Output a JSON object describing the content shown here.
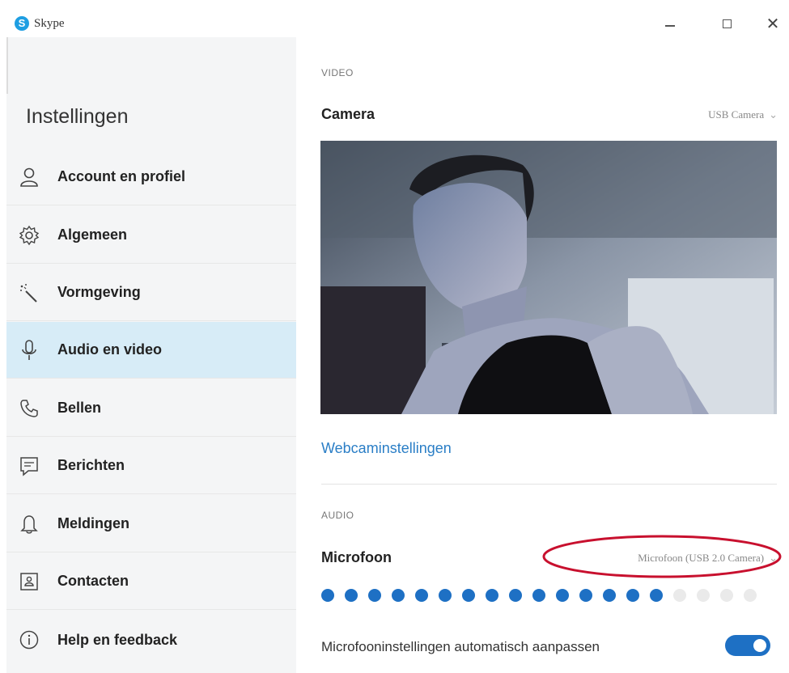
{
  "window": {
    "title": "Skype",
    "logo_letter": "S",
    "close_glyph": "✕"
  },
  "sidebar": {
    "title": "Instellingen",
    "items": [
      {
        "label": "Account en profiel",
        "icon": "person-icon",
        "active": false
      },
      {
        "label": "Algemeen",
        "icon": "gear-icon",
        "active": false
      },
      {
        "label": "Vormgeving",
        "icon": "magic-wand-icon",
        "active": false
      },
      {
        "label": "Audio en video",
        "icon": "microphone-icon",
        "active": true
      },
      {
        "label": "Bellen",
        "icon": "phone-icon",
        "active": false
      },
      {
        "label": "Berichten",
        "icon": "message-icon",
        "active": false
      },
      {
        "label": "Meldingen",
        "icon": "bell-icon",
        "active": false
      },
      {
        "label": "Contacten",
        "icon": "contact-card-icon",
        "active": false
      },
      {
        "label": "Help en feedback",
        "icon": "info-icon",
        "active": false
      }
    ]
  },
  "video": {
    "section": "VIDEO",
    "camera_label": "Camera",
    "camera_value": "USB Camera",
    "webcam_settings_link": "Webcaminstellingen"
  },
  "audio": {
    "section": "AUDIO",
    "microphone_label": "Microfoon",
    "microphone_value": "Microfoon (USB 2.0 Camera)",
    "level": {
      "filled": 15,
      "total": 19
    },
    "auto_adjust_label": "Microfooninstellingen automatisch aanpassen",
    "auto_adjust_on": true
  },
  "colors": {
    "accent": "#1e70c4",
    "level_filled": "#1e70c4",
    "level_empty": "#eaeaea",
    "active_item_bg": "#d7ecf7",
    "highlight_circle": "#c8102e"
  }
}
